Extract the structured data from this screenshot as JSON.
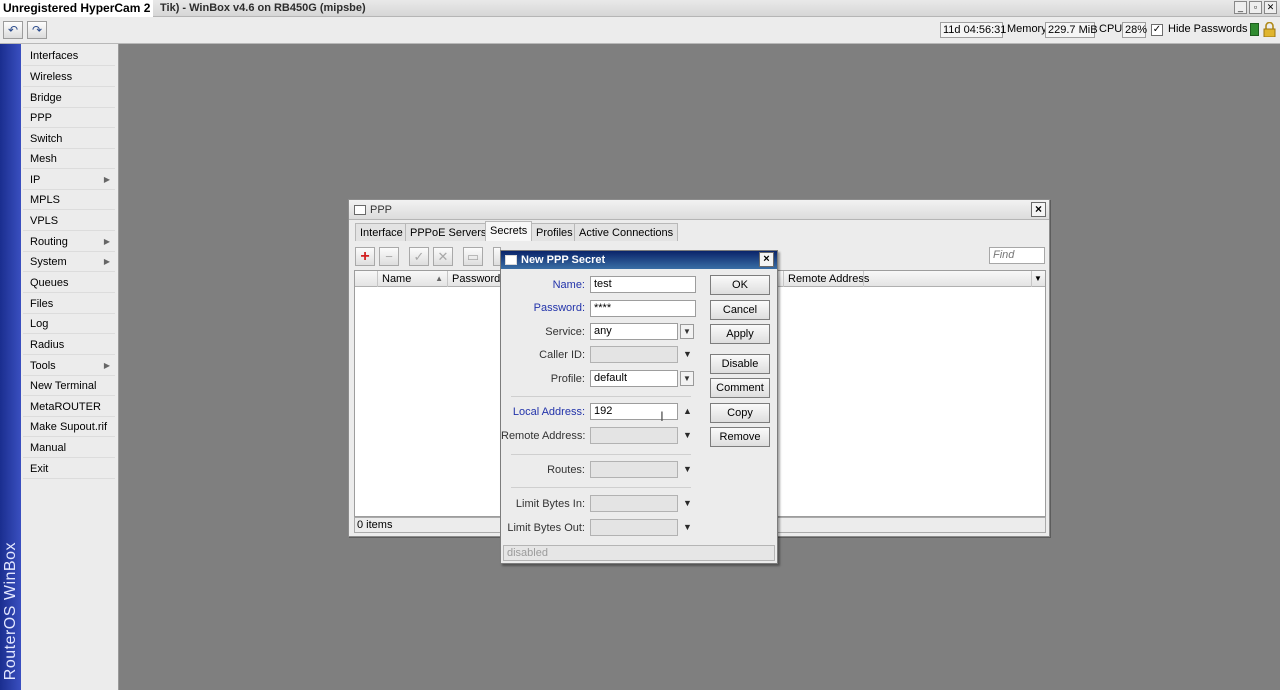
{
  "titlebar": {
    "watermark": "Unregistered HyperCam 2",
    "title": "Tik) - WinBox v4.6 on RB450G (mipsbe)",
    "controls": [
      "minimize",
      "restore",
      "close"
    ]
  },
  "toolbar": {
    "undo_icon": "undo-icon",
    "redo_icon": "redo-icon",
    "uptime": "11d 04:56:31",
    "memory_label": "Memory:",
    "memory_value": "229.7 MiB",
    "cpu_label": "CPU:",
    "cpu_value": "28%",
    "hide_passwords_label": "Hide Passwords",
    "hide_passwords_checked": true,
    "status_color": "#2f8a2f"
  },
  "sidebar": {
    "brand": "RouterOS WinBox",
    "items": [
      {
        "label": "Interfaces",
        "submenu": false
      },
      {
        "label": "Wireless",
        "submenu": false
      },
      {
        "label": "Bridge",
        "submenu": false
      },
      {
        "label": "PPP",
        "submenu": false
      },
      {
        "label": "Switch",
        "submenu": false
      },
      {
        "label": "Mesh",
        "submenu": false
      },
      {
        "label": "IP",
        "submenu": true
      },
      {
        "label": "MPLS",
        "submenu": false
      },
      {
        "label": "VPLS",
        "submenu": false
      },
      {
        "label": "Routing",
        "submenu": true
      },
      {
        "label": "System",
        "submenu": true
      },
      {
        "label": "Queues",
        "submenu": false
      },
      {
        "label": "Files",
        "submenu": false
      },
      {
        "label": "Log",
        "submenu": false
      },
      {
        "label": "Radius",
        "submenu": false
      },
      {
        "label": "Tools",
        "submenu": true
      },
      {
        "label": "New Terminal",
        "submenu": false
      },
      {
        "label": "MetaROUTER",
        "submenu": false
      },
      {
        "label": "Make Supout.rif",
        "submenu": false
      },
      {
        "label": "Manual",
        "submenu": false
      },
      {
        "label": "Exit",
        "submenu": false
      }
    ]
  },
  "ppp_window": {
    "title": "PPP",
    "tabs": [
      {
        "label": "Interface",
        "active": false
      },
      {
        "label": "PPPoE Servers",
        "active": false
      },
      {
        "label": "Secrets",
        "active": true
      },
      {
        "label": "Profiles",
        "active": false
      },
      {
        "label": "Active Connections",
        "active": false
      }
    ],
    "find_placeholder": "Find",
    "columns": {
      "name": "Name",
      "password": "Password",
      "remote_address": "Remote Address"
    },
    "status": "0 items"
  },
  "dialog": {
    "title": "New PPP Secret",
    "fields": {
      "name": {
        "label": "Name:",
        "value": "test"
      },
      "password": {
        "label": "Password:",
        "value": "****"
      },
      "service": {
        "label": "Service:",
        "value": "any"
      },
      "caller_id": {
        "label": "Caller ID:",
        "value": ""
      },
      "profile": {
        "label": "Profile:",
        "value": "default"
      },
      "local_address": {
        "label": "Local Address:",
        "value": "192"
      },
      "remote_address": {
        "label": "Remote Address:",
        "value": ""
      },
      "routes": {
        "label": "Routes:",
        "value": ""
      },
      "limit_bytes_in": {
        "label": "Limit Bytes In:",
        "value": ""
      },
      "limit_bytes_out": {
        "label": "Limit Bytes Out:",
        "value": ""
      }
    },
    "buttons": {
      "ok": "OK",
      "cancel": "Cancel",
      "apply": "Apply",
      "disable": "Disable",
      "comment": "Comment",
      "copy": "Copy",
      "remove": "Remove"
    },
    "status": "disabled"
  }
}
